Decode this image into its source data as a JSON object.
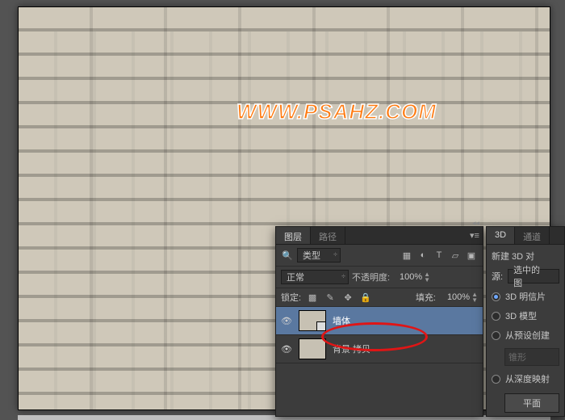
{
  "watermark": "WWW.PSAHZ.COM",
  "layersPanel": {
    "tabs": [
      "图层",
      "路径"
    ],
    "activeTab": 0,
    "filter": {
      "kind": "类型",
      "search_icon": "search"
    },
    "blend": {
      "mode": "正常",
      "opacity_label": "不透明度:",
      "opacity_value": "100%"
    },
    "lock": {
      "label": "锁定:",
      "fill_label": "填充:",
      "fill_value": "100%"
    },
    "layers": [
      {
        "name": "墙体",
        "visible": true,
        "selected": true,
        "type": "smart"
      },
      {
        "name": "背景 拷贝",
        "visible": true,
        "selected": false,
        "type": "raster"
      }
    ]
  },
  "threeDPanel": {
    "tabs": [
      "3D",
      "通道"
    ],
    "activeTab": 0,
    "title": "新建 3D 对",
    "source_label": "源:",
    "source_value": "选中的图",
    "options": [
      {
        "label": "3D 明信片",
        "checked": true
      },
      {
        "label": "3D 模型",
        "checked": false
      },
      {
        "label": "从预设创建",
        "checked": false,
        "sub": "锥形"
      },
      {
        "label": "从深度映射",
        "checked": false,
        "sub": "平面"
      }
    ]
  }
}
